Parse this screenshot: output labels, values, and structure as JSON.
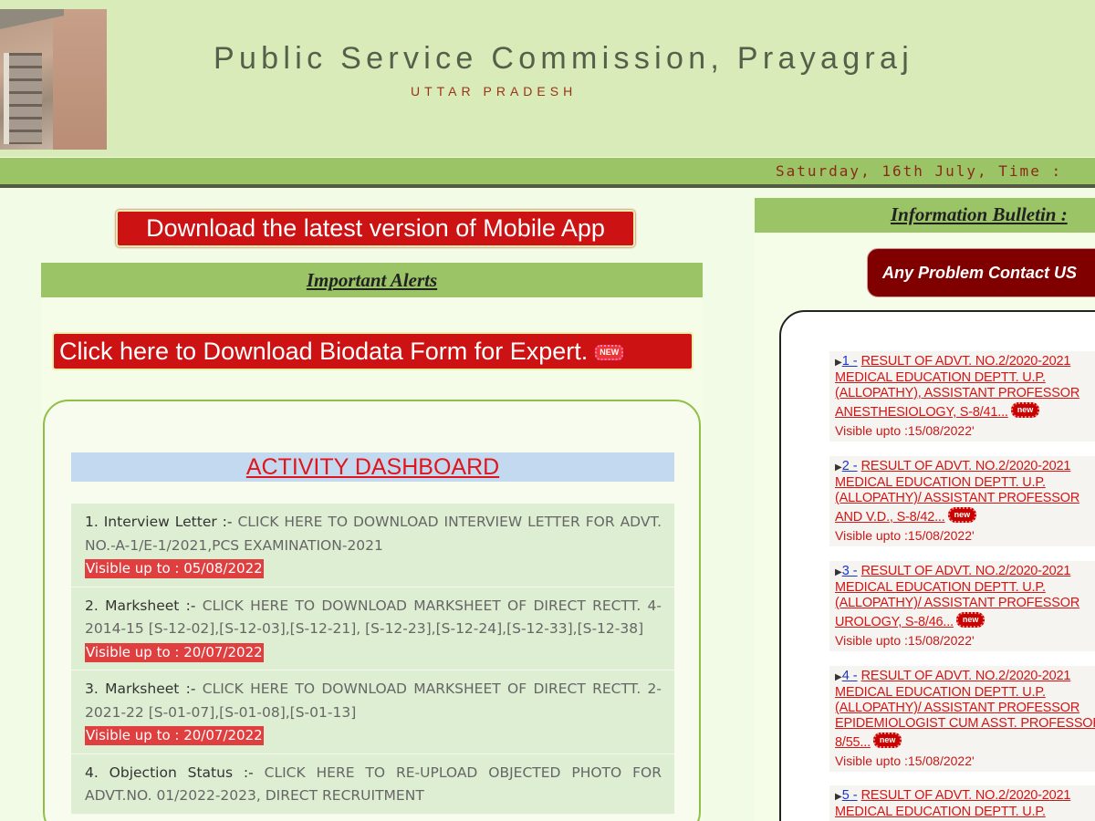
{
  "header": {
    "title": "Public Service Commission, Prayagraj",
    "subtitle": "UTTAR PRADESH"
  },
  "date_bar": {
    "text": "Saturday, 16th July, Time :"
  },
  "left": {
    "app_button": "Download the latest version of Mobile App",
    "alerts_heading": "Important Alerts",
    "biodata_button": "Click here to Download Biodata Form for Expert.",
    "new_badge": "NEW",
    "dashboard_title": "ACTIVITY DASHBOARD",
    "dashboard_items": [
      {
        "label": "1. Interview Letter :-",
        "desc": "CLICK HERE TO DOWNLOAD INTERVIEW LETTER FOR ADVT. NO.-A-1/E-1/2021,PCS EXAMINATION-2021",
        "visible": "Visible up to : 05/08/2022"
      },
      {
        "label": "2. Marksheet :-",
        "desc": "CLICK HERE TO DOWNLOAD MARKSHEET OF DIRECT RECTT. 4-2014-15 [S-12-02],[S-12-03],[S-12-21], [S-12-23],[S-12-24],[S-12-33],[S-12-38]",
        "visible": "Visible up to : 20/07/2022"
      },
      {
        "label": "3. Marksheet :-",
        "desc": "CLICK HERE TO DOWNLOAD MARKSHEET OF DIRECT RECTT. 2-2021-22 [S-01-07],[S-01-08],[S-01-13]",
        "visible": "Visible up to : 20/07/2022"
      },
      {
        "label": "4. Objection Status :-",
        "desc": "CLICK HERE TO RE-UPLOAD OBJECTED PHOTO FOR ADVT.NO. 01/2022-2023, DIRECT RECRUITMENT",
        "visible": ""
      }
    ]
  },
  "right": {
    "info_heading": "Information Bulletin :",
    "contact_button": "Any Problem Contact US",
    "new_badge": "new",
    "bulletin_items": [
      {
        "num": "1 -",
        "lines": [
          "RESULT OF ADVT. NO.2/2020-2021",
          "MEDICAL EDUCATION DEPTT. U.P.",
          "(ALLOPATHY), ASSISTANT PROFESSOR",
          "ANESTHESIOLOGY, S-8/41..."
        ],
        "visible": "Visible upto :15/08/2022'"
      },
      {
        "num": "2 -",
        "lines": [
          "RESULT OF ADVT. NO.2/2020-2021",
          "MEDICAL EDUCATION DEPTT. U.P.",
          "(ALLOPATHY)/ ASSISTANT PROFESSOR",
          "AND V.D., S-8/42..."
        ],
        "visible": "Visible upto :15/08/2022'"
      },
      {
        "num": "3 -",
        "lines": [
          "RESULT OF ADVT. NO.2/2020-2021",
          "MEDICAL EDUCATION DEPTT. U.P.",
          "(ALLOPATHY)/ ASSISTANT PROFESSOR",
          "UROLOGY, S-8/46..."
        ],
        "visible": "Visible upto :15/08/2022'"
      },
      {
        "num": "4 -",
        "lines": [
          "RESULT OF ADVT. NO.2/2020-2021",
          "MEDICAL EDUCATION DEPTT. U.P.",
          "(ALLOPATHY)/ ASSISTANT PROFESSOR",
          "EPIDEMIOLOGIST CUM ASST. PROFESSOR",
          "8/55..."
        ],
        "visible": "Visible upto :15/08/2022'"
      },
      {
        "num": "5 -",
        "lines": [
          "RESULT OF ADVT. NO.2/2020-2021",
          "MEDICAL EDUCATION DEPTT. U.P."
        ],
        "visible": ""
      }
    ]
  }
}
